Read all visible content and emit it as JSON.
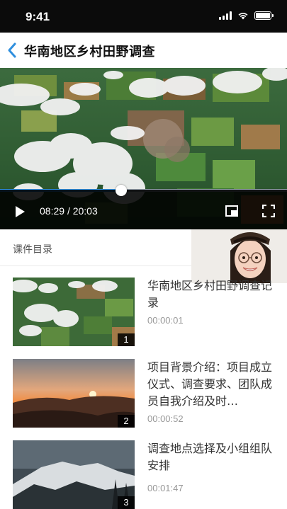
{
  "status_bar": {
    "time": "9:41"
  },
  "nav": {
    "title": "华南地区乡村田野调查",
    "back_icon": "chevron-left-icon"
  },
  "player": {
    "current_time": "08:29",
    "separator": "/",
    "total_time": "20:03",
    "progress": 0.423,
    "play_icon": "play-icon",
    "pip_icon": "picture-in-picture-icon",
    "fullscreen_icon": "fullscreen-icon"
  },
  "section": {
    "title": "课件目录"
  },
  "lessons": [
    {
      "index": "1",
      "title": "华南地区乡村田野调查记录",
      "duration": "00:00:01",
      "thumb": "aerial-farmland"
    },
    {
      "index": "2",
      "title": "项目背景介绍：项目成立仪式、调查要求、团队成员自我介绍及时…",
      "duration": "00:00:52",
      "thumb": "sunset-mountains"
    },
    {
      "index": "3",
      "title": "调查地点选择及小组组队安排",
      "duration": "00:01:47",
      "thumb": "snowy-mountain"
    }
  ],
  "colors": {
    "accent": "#2f8fde",
    "status_bar_bg": "#0b0b0b",
    "control_bg": "#000000"
  }
}
